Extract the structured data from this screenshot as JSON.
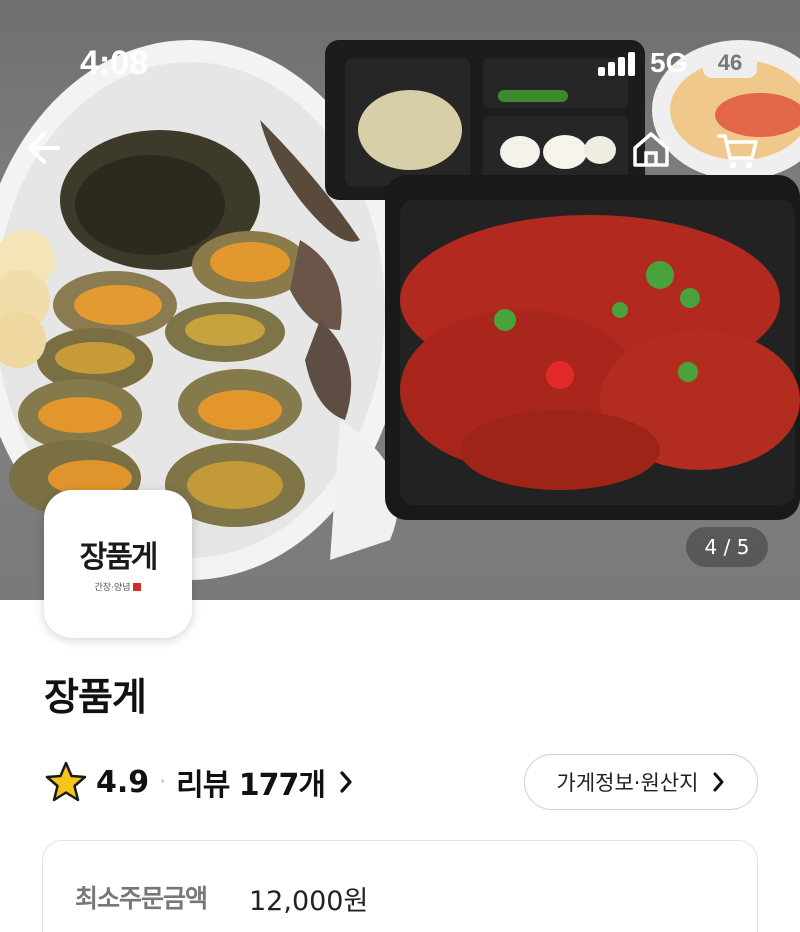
{
  "status_bar": {
    "time": "4:08",
    "network": "5G",
    "battery": "46"
  },
  "gallery": {
    "counter": "4 / 5"
  },
  "logo": {
    "text": "장품게",
    "subtext": "간장·양념"
  },
  "store": {
    "name": "장품게",
    "rating": "4.9",
    "separator": "·",
    "reviews_label": "리뷰 177개",
    "info_button_label": "가게정보·원산지"
  },
  "order_info": {
    "min_order_label": "최소주문금액",
    "min_order_value": "12,000원"
  },
  "colors": {
    "star": "#f5c518",
    "accent_text": "#111111",
    "muted_text": "#777777"
  },
  "icons": [
    "back-arrow-icon",
    "home-icon",
    "cart-icon",
    "star-icon",
    "chevron-right-icon",
    "signal-icon"
  ]
}
